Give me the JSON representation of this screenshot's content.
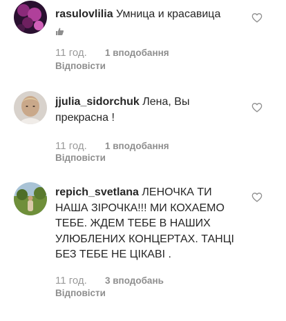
{
  "comments": [
    {
      "username": "rasulovlilia",
      "text": "Умница и красавица",
      "emoji": "thumbs-up",
      "time": "11 год.",
      "likes": "1 вподобання",
      "reply": "Відповісти"
    },
    {
      "username": "jjulia_sidorchuk",
      "text": "Лена, Вы прекрасна !",
      "time": "11 год.",
      "likes": "1 вподобання",
      "reply": "Відповісти"
    },
    {
      "username": "repich_svetlana",
      "text": "ЛЕНОЧКА ТИ НАША ЗІРОЧКА!!! МИ КОХАЕМО ТЕБЕ. ЖДЕМ ТЕБЕ В НАШИХ УЛЮБЛЕНИХ КОНЦЕРТАХ. ТАНЦІ БЕЗ ТЕБЕ НЕ ЦІКАВІ .",
      "time": "11 год.",
      "likes": "3 вподобань",
      "reply": "Відповісти"
    }
  ],
  "icons": {
    "like": "heart-outline-icon",
    "avatar_1": "avatar-flowers",
    "avatar_2": "avatar-portrait",
    "avatar_3": "avatar-outdoor"
  },
  "colors": {
    "text": "#262626",
    "meta": "#8e8e8e",
    "background": "#ffffff"
  }
}
